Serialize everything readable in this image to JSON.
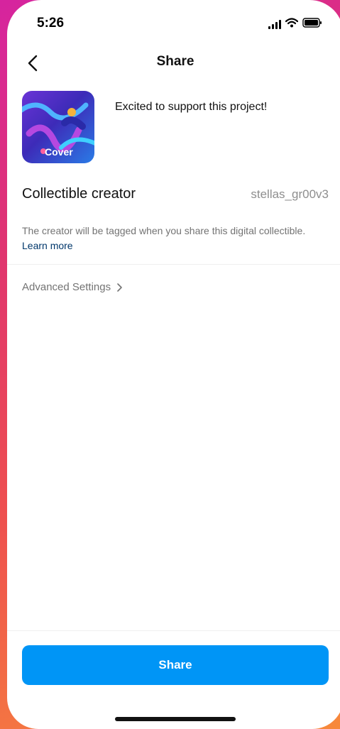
{
  "status_bar": {
    "time": "5:26"
  },
  "header": {
    "title": "Share"
  },
  "post": {
    "cover_label": "Cover",
    "caption": "Excited to support this project!"
  },
  "creator": {
    "label": "Collectible creator",
    "username": "stellas_gr00v3"
  },
  "info": {
    "text": "The creator will be tagged when you share this digital collectible.",
    "link": "Learn more"
  },
  "advanced": {
    "label": "Advanced Settings"
  },
  "footer": {
    "share_label": "Share"
  },
  "colors": {
    "accent": "#0095f6",
    "link": "#00376b",
    "muted": "#8e8e8e"
  }
}
